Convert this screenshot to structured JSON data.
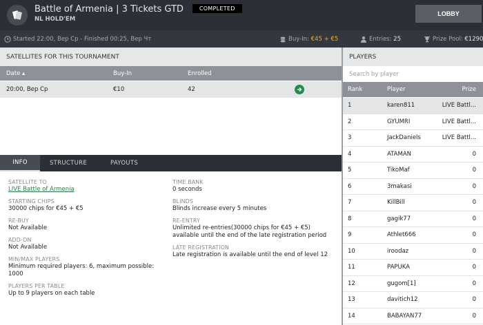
{
  "header": {
    "title": "Battle of Armenia | 3 Tickets GTD",
    "status": "COMPLETED",
    "subtitle": "NL HOLD'EM",
    "lobby_label": "LOBBY"
  },
  "infobar": {
    "times": "Started 22:00, Вер Ср - Finished 00:25, Вер Чт",
    "buyin_label": "Buy-In:",
    "buyin_value": "€45 + €5",
    "entries_label": "Entries:",
    "entries_value": "25",
    "prize_label": "Prize Pool:",
    "prize_value": "€1290"
  },
  "satellites": {
    "heading": "SATELLITES FOR THIS TOURNAMENT",
    "columns": [
      "Date ▴",
      "Buy-In",
      "Enrolled"
    ],
    "rows": [
      {
        "date": "20:00, Вер Ср",
        "buyin": "€10",
        "enrolled": "42"
      }
    ]
  },
  "tabs": [
    "INFO",
    "STRUCTURE",
    "PAYOUTS"
  ],
  "info": {
    "satellite_to_label": "SATELLITE TO",
    "satellite_to_value": "LIVE Battle of Armenia",
    "starting_chips_label": "STARTING CHIPS",
    "starting_chips_value": "30000 chips for €45 + €5",
    "rebuy_label": "RE-BUY",
    "rebuy_value": "Not Available",
    "addon_label": "ADD-ON",
    "addon_value": "Not Available",
    "minmax_label": "MIN/MAX PLAYERS",
    "minmax_value": "Minimum required players: 6, maximum possible: 1000",
    "per_table_label": "PLAYERS PER TABLE",
    "per_table_value": "Up to 9 players on each table",
    "time_bank_label": "TIME BANK",
    "time_bank_value": "0 seconds",
    "blinds_label": "BLINDS",
    "blinds_value": "Blinds increase every 5 minutes",
    "reentry_label": "RE-ENTRY",
    "reentry_value": "Unlimited re-entries(30000 chips for €45 + €5) available until the end of the late registration period",
    "late_reg_label": "LATE REGISTRATION",
    "late_reg_value": "Late registration is available until the end of level 12"
  },
  "players": {
    "heading": "PLAYERS",
    "search_placeholder": "Search by player",
    "columns": [
      "Rank",
      "Player",
      "Prize"
    ],
    "rows": [
      {
        "rank": "1",
        "name": "karen811",
        "prize": "LIVE Battl..."
      },
      {
        "rank": "2",
        "name": "GYUMRI",
        "prize": "LIVE Battl..."
      },
      {
        "rank": "3",
        "name": "JackDaniels",
        "prize": "LIVE Battl..."
      },
      {
        "rank": "4",
        "name": "ATAMAN",
        "prize": "0"
      },
      {
        "rank": "5",
        "name": "TikoMaf",
        "prize": "0"
      },
      {
        "rank": "6",
        "name": "3makasi",
        "prize": "0"
      },
      {
        "rank": "7",
        "name": "KillBill",
        "prize": "0"
      },
      {
        "rank": "8",
        "name": "gagik77",
        "prize": "0"
      },
      {
        "rank": "9",
        "name": "Athlet666",
        "prize": "0"
      },
      {
        "rank": "10",
        "name": "iroodaz",
        "prize": "0"
      },
      {
        "rank": "11",
        "name": "PAPUKA",
        "prize": "0"
      },
      {
        "rank": "12",
        "name": "gugom[1]",
        "prize": "0"
      },
      {
        "rank": "13",
        "name": "davitich12",
        "prize": "0"
      },
      {
        "rank": "14",
        "name": "BABAYAN77",
        "prize": "0"
      }
    ]
  },
  "colors": {
    "header_bg": "#2c2f36",
    "accent_green": "#2a8a4e",
    "gold": "#e8b040"
  }
}
